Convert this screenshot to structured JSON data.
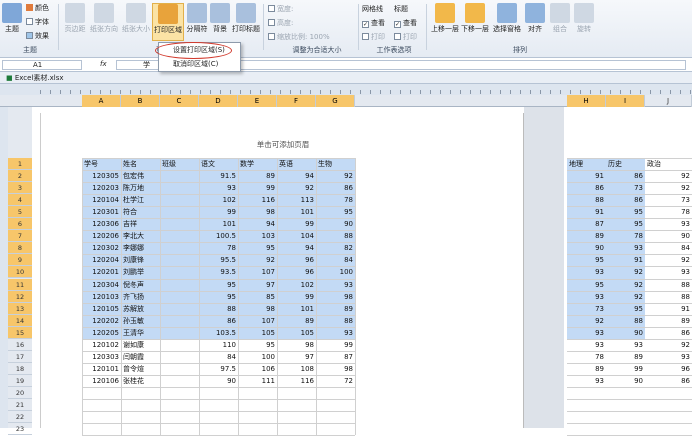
{
  "ribbon": {
    "theme_group": {
      "theme": "主题",
      "colors": "颜色",
      "fonts": "字体",
      "effects": "效果",
      "label": "主题"
    },
    "page_setup": {
      "margins": "页边距",
      "orientation": "纸张方向",
      "size": "纸张大小",
      "print_area": "打印区域",
      "breaks": "分隔符",
      "background": "背景",
      "print_titles": "打印标题",
      "label": "页面设置"
    },
    "scale": {
      "width": "宽度:",
      "height": "高度:",
      "scale_label": "缩放比例:",
      "scale_value": "100%",
      "group_label": "调整为合适大小"
    },
    "sheet_options": {
      "gridlines": "网格线",
      "headings": "标题",
      "view1": "查看",
      "view2": "查看",
      "print1": "打印",
      "print2": "打印",
      "label": "工作表选项"
    },
    "arrange": {
      "bring_forward": "上移一层",
      "send_backward": "下移一层",
      "selection_pane": "选择窗格",
      "align": "对齐",
      "group": "组合",
      "rotate": "旋转",
      "label": "排列"
    }
  },
  "menu": {
    "set_print_area": "设置打印区域(S)",
    "clear_print_area": "取消印区域(C)"
  },
  "formula_bar": {
    "name_box": "A1",
    "fx": "fx",
    "value": "学"
  },
  "workbook_tab": "Excel素材.xlsx",
  "header_hint": "单击可添加页眉",
  "columns_left": [
    "A",
    "B",
    "C",
    "D",
    "E",
    "F",
    "G"
  ],
  "columns_right": [
    "H",
    "I",
    "J"
  ],
  "row_numbers": [
    "1",
    "2",
    "3",
    "4",
    "5",
    "6",
    "7",
    "8",
    "9",
    "10",
    "11",
    "12",
    "13",
    "14",
    "15",
    "16",
    "17",
    "18",
    "19",
    "20",
    "21",
    "22",
    "23"
  ],
  "headers": [
    "学号",
    "姓名",
    "班级",
    "语文",
    "数学",
    "英语",
    "生物"
  ],
  "rows": [
    [
      "120305",
      "包宏伟",
      "",
      "91.5",
      "89",
      "94",
      "92"
    ],
    [
      "120203",
      "陈万地",
      "",
      "93",
      "99",
      "92",
      "86"
    ],
    [
      "120104",
      "杜学江",
      "",
      "102",
      "116",
      "113",
      "78"
    ],
    [
      "120301",
      "符合",
      "",
      "99",
      "98",
      "101",
      "95"
    ],
    [
      "120306",
      "吉祥",
      "",
      "101",
      "94",
      "99",
      "90"
    ],
    [
      "120206",
      "李北大",
      "",
      "100.5",
      "103",
      "104",
      "88"
    ],
    [
      "120302",
      "李娜娜",
      "",
      "78",
      "95",
      "94",
      "82"
    ],
    [
      "120204",
      "刘康锋",
      "",
      "95.5",
      "92",
      "96",
      "84"
    ],
    [
      "120201",
      "刘鹏举",
      "",
      "93.5",
      "107",
      "96",
      "100"
    ],
    [
      "120304",
      "倪冬声",
      "",
      "95",
      "97",
      "102",
      "93"
    ],
    [
      "120103",
      "齐飞扬",
      "",
      "95",
      "85",
      "99",
      "98"
    ],
    [
      "120105",
      "苏解放",
      "",
      "88",
      "98",
      "101",
      "89"
    ],
    [
      "120202",
      "孙玉敏",
      "",
      "86",
      "107",
      "89",
      "88"
    ],
    [
      "120205",
      "王清华",
      "",
      "103.5",
      "105",
      "105",
      "93"
    ],
    [
      "120102",
      "谢如康",
      "",
      "110",
      "95",
      "98",
      "99"
    ],
    [
      "120303",
      "闫朝霞",
      "",
      "84",
      "100",
      "97",
      "87"
    ],
    [
      "120101",
      "曾令煊",
      "",
      "97.5",
      "106",
      "108",
      "98"
    ],
    [
      "120106",
      "张桂花",
      "",
      "90",
      "111",
      "116",
      "72"
    ]
  ],
  "right_headers": [
    "地理",
    "历史",
    "政治"
  ],
  "right_rows": [
    [
      "91",
      "86",
      "92"
    ],
    [
      "86",
      "73",
      "92"
    ],
    [
      "88",
      "86",
      "73"
    ],
    [
      "91",
      "95",
      "78"
    ],
    [
      "87",
      "95",
      "93"
    ],
    [
      "89",
      "78",
      "90"
    ],
    [
      "90",
      "93",
      "84"
    ],
    [
      "95",
      "91",
      "92"
    ],
    [
      "93",
      "92",
      "93"
    ],
    [
      "95",
      "92",
      "88"
    ],
    [
      "93",
      "92",
      "88"
    ],
    [
      "73",
      "95",
      "91"
    ],
    [
      "92",
      "88",
      "89"
    ],
    [
      "93",
      "90",
      "86"
    ],
    [
      "93",
      "93",
      "92"
    ],
    [
      "78",
      "89",
      "93"
    ],
    [
      "89",
      "99",
      "96"
    ],
    [
      "93",
      "90",
      "86"
    ]
  ],
  "colors": {
    "accent": "#f7c66a",
    "selection": "#b8d4f3",
    "ring": "#d23b2e"
  }
}
